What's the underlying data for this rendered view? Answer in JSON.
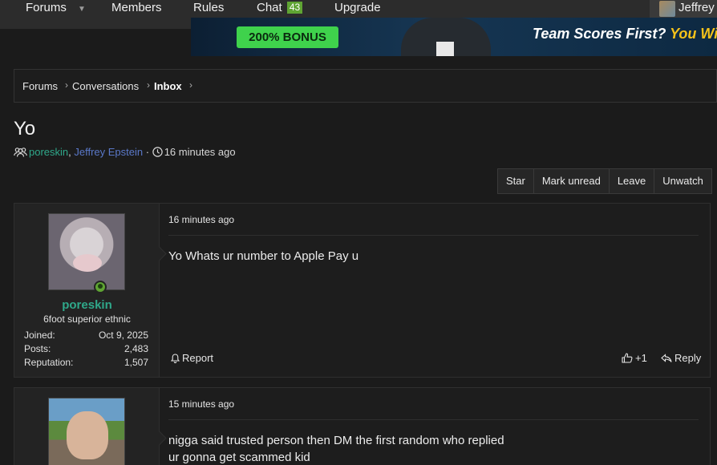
{
  "nav": {
    "forums": "Forums",
    "members": "Members",
    "rules": "Rules",
    "chat": "Chat",
    "chat_count": "43",
    "upgrade": "Upgrade",
    "user": "Jeffrey"
  },
  "banner": {
    "bonus": "200% BONUS",
    "text_white": "Team Scores First?",
    "text_yellow": "You Wi"
  },
  "breadcrumb": [
    "Forums",
    "Conversations",
    "Inbox"
  ],
  "conversation": {
    "title": "Yo",
    "participant_1": "poreskin",
    "participant_2": "Jeffrey Epstein",
    "time": "16 minutes ago"
  },
  "actions": [
    "Star",
    "Mark unread",
    "Leave",
    "Unwatch"
  ],
  "messages": [
    {
      "time": "16 minutes ago",
      "body": "Yo Whats ur number to Apple Pay u",
      "user": {
        "name": "poreskin",
        "title": "6foot superior ethnic",
        "joined_label": "Joined:",
        "joined": "Oct 9, 2025",
        "posts_label": "Posts:",
        "posts": "2,483",
        "rep_label": "Reputation:",
        "rep": "1,507"
      },
      "report": "Report",
      "like": "+1",
      "reply": "Reply"
    },
    {
      "time": "15 minutes ago",
      "body_line1": "nigga said trusted person then DM the first random who replied",
      "body_line2": "ur gonna get scammed kid"
    }
  ]
}
